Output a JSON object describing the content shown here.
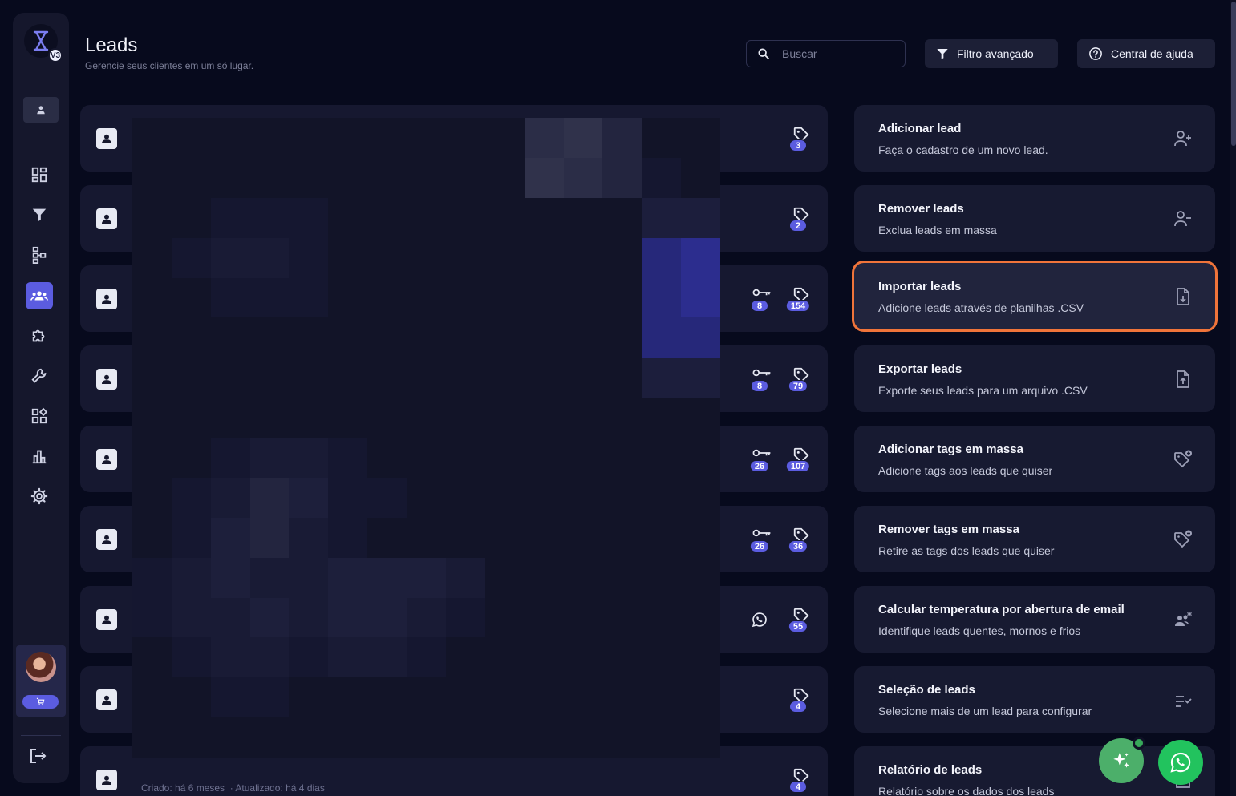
{
  "header": {
    "title": "Leads",
    "subtitle": "Gerencie seus clientes em um só lugar.",
    "search_placeholder": "Buscar",
    "filter_label": "Filtro avançado",
    "help_label": "Central de ajuda"
  },
  "sidebar": {
    "logo_badge": "V3",
    "items": [
      "dashboard-icon",
      "funnel-icon",
      "flow-icon",
      "leads-icon",
      "integrations-icon",
      "tools-icon",
      "apps-icon",
      "reports-icon",
      "settings-icon"
    ],
    "active_item": "leads-icon"
  },
  "leads": [
    {
      "keys": null,
      "tags": "3",
      "whatsapp": false
    },
    {
      "keys": null,
      "tags": "2",
      "whatsapp": false
    },
    {
      "keys": "8",
      "tags": "154",
      "whatsapp": false
    },
    {
      "keys": "8",
      "tags": "79",
      "whatsapp": false
    },
    {
      "keys": "26",
      "tags": "107",
      "whatsapp": false
    },
    {
      "keys": "26",
      "tags": "36",
      "whatsapp": false
    },
    {
      "keys": null,
      "tags": "55",
      "whatsapp": true
    },
    {
      "keys": null,
      "tags": "4",
      "whatsapp": false
    },
    {
      "keys": null,
      "tags": "4",
      "whatsapp": false
    }
  ],
  "last_lead_meta": {
    "created": "Criado: há 6 meses",
    "updated": "Atualizado: há 4 dias"
  },
  "actions": [
    {
      "title": "Adicionar lead",
      "desc": "Faça o cadastro de um novo lead.",
      "icon": "user-add-icon"
    },
    {
      "title": "Remover leads",
      "desc": "Exclua leads em massa",
      "icon": "user-remove-icon"
    },
    {
      "title": "Importar leads",
      "desc": "Adicione leads através de planilhas .CSV",
      "icon": "file-import-icon"
    },
    {
      "title": "Exportar leads",
      "desc": "Exporte seus leads para um arquivo .CSV",
      "icon": "file-export-icon"
    },
    {
      "title": "Adicionar tags em massa",
      "desc": "Adicione tags aos leads que quiser",
      "icon": "tag-add-icon"
    },
    {
      "title": "Remover tags em massa",
      "desc": "Retire as tags dos leads que quiser",
      "icon": "tag-remove-icon"
    },
    {
      "title": "Calcular temperatura por abertura de email",
      "desc": "Identifique leads quentes, mornos e frios",
      "icon": "temperature-users-icon"
    },
    {
      "title": "Seleção de leads",
      "desc": "Selecione mais de um lead para configurar",
      "icon": "checklist-icon"
    },
    {
      "title": "Relatório de leads",
      "desc": "Relatório sobre os dados dos leads",
      "icon": "report-icon"
    }
  ],
  "colors": {
    "accent": "#5b5ce0",
    "highlight": "#f0743a",
    "whatsapp": "#22c35e"
  }
}
